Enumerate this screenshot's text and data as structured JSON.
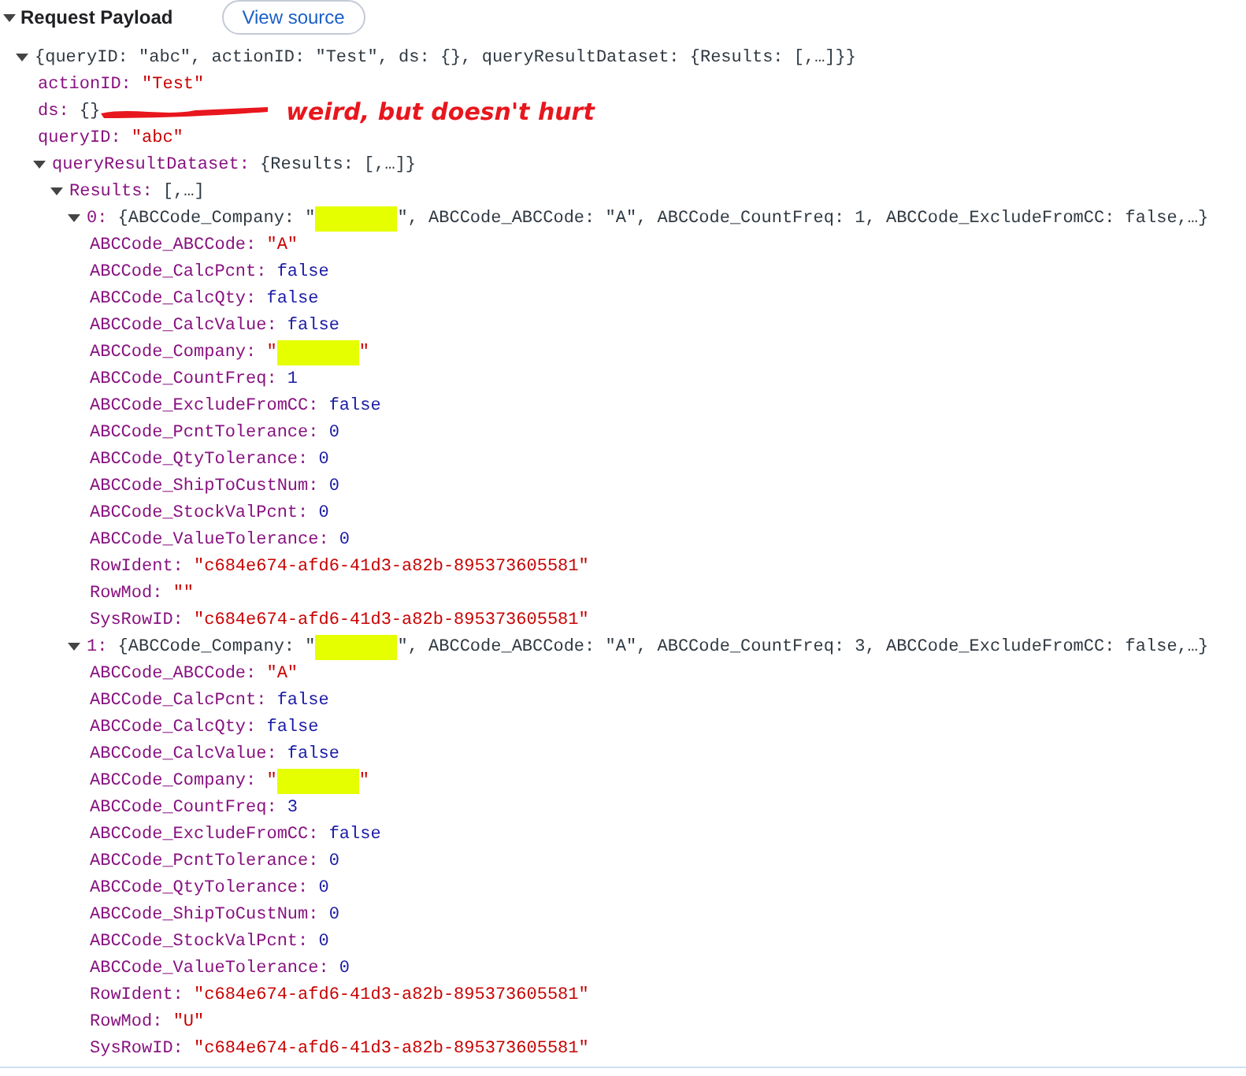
{
  "header": {
    "title": "Request Payload",
    "expanded": true,
    "view_source_button": "View source"
  },
  "tree": {
    "summary": [
      {
        "kind": "plain",
        "text": "{queryID: \"abc\", actionID: \"Test\", ds: {}, queryResultDataset: {Results: [,…]}}"
      }
    ],
    "expanded": true,
    "children": [
      {
        "key": "actionID:",
        "value": [
          {
            "kind": "string",
            "text": "\"Test\""
          }
        ]
      },
      {
        "key": "ds:",
        "value": [
          {
            "kind": "plain",
            "text": "{}"
          }
        ],
        "annotation": "weird, but doesn't hurt"
      },
      {
        "key": "queryID:",
        "value": [
          {
            "kind": "string",
            "text": "\"abc\""
          }
        ]
      },
      {
        "key": "queryResultDataset:",
        "summary": [
          {
            "kind": "plain",
            "text": "{Results: [,…]}"
          }
        ],
        "expanded": true,
        "children": [
          {
            "key": "Results:",
            "summary": [
              {
                "kind": "plain",
                "text": "[,…]"
              }
            ],
            "expanded": true,
            "children": [
              {
                "key": "0:",
                "summary": [
                  {
                    "kind": "plain",
                    "text": "{ABCCode_Company: \""
                  },
                  {
                    "kind": "redaction"
                  },
                  {
                    "kind": "plain",
                    "text": "\", ABCCode_ABCCode: \"A\", ABCCode_CountFreq: 1, ABCCode_ExcludeFromCC: false,…}"
                  }
                ],
                "expanded": true,
                "children": [
                  {
                    "key": "ABCCode_ABCCode:",
                    "value": [
                      {
                        "kind": "string",
                        "text": "\"A\""
                      }
                    ]
                  },
                  {
                    "key": "ABCCode_CalcPcnt:",
                    "value": [
                      {
                        "kind": "literal",
                        "text": "false"
                      }
                    ]
                  },
                  {
                    "key": "ABCCode_CalcQty:",
                    "value": [
                      {
                        "kind": "literal",
                        "text": "false"
                      }
                    ]
                  },
                  {
                    "key": "ABCCode_CalcValue:",
                    "value": [
                      {
                        "kind": "literal",
                        "text": "false"
                      }
                    ]
                  },
                  {
                    "key": "ABCCode_Company:",
                    "value": [
                      {
                        "kind": "string",
                        "text": "\""
                      },
                      {
                        "kind": "redaction"
                      },
                      {
                        "kind": "string",
                        "text": "\""
                      }
                    ]
                  },
                  {
                    "key": "ABCCode_CountFreq:",
                    "value": [
                      {
                        "kind": "literal",
                        "text": "1"
                      }
                    ]
                  },
                  {
                    "key": "ABCCode_ExcludeFromCC:",
                    "value": [
                      {
                        "kind": "literal",
                        "text": "false"
                      }
                    ]
                  },
                  {
                    "key": "ABCCode_PcntTolerance:",
                    "value": [
                      {
                        "kind": "literal",
                        "text": "0"
                      }
                    ]
                  },
                  {
                    "key": "ABCCode_QtyTolerance:",
                    "value": [
                      {
                        "kind": "literal",
                        "text": "0"
                      }
                    ]
                  },
                  {
                    "key": "ABCCode_ShipToCustNum:",
                    "value": [
                      {
                        "kind": "literal",
                        "text": "0"
                      }
                    ]
                  },
                  {
                    "key": "ABCCode_StockValPcnt:",
                    "value": [
                      {
                        "kind": "literal",
                        "text": "0"
                      }
                    ]
                  },
                  {
                    "key": "ABCCode_ValueTolerance:",
                    "value": [
                      {
                        "kind": "literal",
                        "text": "0"
                      }
                    ]
                  },
                  {
                    "key": "RowIdent:",
                    "value": [
                      {
                        "kind": "string",
                        "text": "\"c684e674-afd6-41d3-a82b-895373605581\""
                      }
                    ]
                  },
                  {
                    "key": "RowMod:",
                    "value": [
                      {
                        "kind": "string",
                        "text": "\"\""
                      }
                    ]
                  },
                  {
                    "key": "SysRowID:",
                    "value": [
                      {
                        "kind": "string",
                        "text": "\"c684e674-afd6-41d3-a82b-895373605581\""
                      }
                    ]
                  }
                ]
              },
              {
                "key": "1:",
                "summary": [
                  {
                    "kind": "plain",
                    "text": "{ABCCode_Company: \""
                  },
                  {
                    "kind": "redaction"
                  },
                  {
                    "kind": "plain",
                    "text": "\", ABCCode_ABCCode: \"A\", ABCCode_CountFreq: 3, ABCCode_ExcludeFromCC: false,…}"
                  }
                ],
                "expanded": true,
                "children": [
                  {
                    "key": "ABCCode_ABCCode:",
                    "value": [
                      {
                        "kind": "string",
                        "text": "\"A\""
                      }
                    ]
                  },
                  {
                    "key": "ABCCode_CalcPcnt:",
                    "value": [
                      {
                        "kind": "literal",
                        "text": "false"
                      }
                    ]
                  },
                  {
                    "key": "ABCCode_CalcQty:",
                    "value": [
                      {
                        "kind": "literal",
                        "text": "false"
                      }
                    ]
                  },
                  {
                    "key": "ABCCode_CalcValue:",
                    "value": [
                      {
                        "kind": "literal",
                        "text": "false"
                      }
                    ]
                  },
                  {
                    "key": "ABCCode_Company:",
                    "value": [
                      {
                        "kind": "string",
                        "text": "\""
                      },
                      {
                        "kind": "redaction"
                      },
                      {
                        "kind": "string",
                        "text": "\""
                      }
                    ]
                  },
                  {
                    "key": "ABCCode_CountFreq:",
                    "value": [
                      {
                        "kind": "literal",
                        "text": "3"
                      }
                    ]
                  },
                  {
                    "key": "ABCCode_ExcludeFromCC:",
                    "value": [
                      {
                        "kind": "literal",
                        "text": "false"
                      }
                    ]
                  },
                  {
                    "key": "ABCCode_PcntTolerance:",
                    "value": [
                      {
                        "kind": "literal",
                        "text": "0"
                      }
                    ]
                  },
                  {
                    "key": "ABCCode_QtyTolerance:",
                    "value": [
                      {
                        "kind": "literal",
                        "text": "0"
                      }
                    ]
                  },
                  {
                    "key": "ABCCode_ShipToCustNum:",
                    "value": [
                      {
                        "kind": "literal",
                        "text": "0"
                      }
                    ]
                  },
                  {
                    "key": "ABCCode_StockValPcnt:",
                    "value": [
                      {
                        "kind": "literal",
                        "text": "0"
                      }
                    ]
                  },
                  {
                    "key": "ABCCode_ValueTolerance:",
                    "value": [
                      {
                        "kind": "literal",
                        "text": "0"
                      }
                    ]
                  },
                  {
                    "key": "RowIdent:",
                    "value": [
                      {
                        "kind": "string",
                        "text": "\"c684e674-afd6-41d3-a82b-895373605581\""
                      }
                    ]
                  },
                  {
                    "key": "RowMod:",
                    "value": [
                      {
                        "kind": "string",
                        "text": "\"U\""
                      }
                    ]
                  },
                  {
                    "key": "SysRowID:",
                    "value": [
                      {
                        "kind": "string",
                        "text": "\"c684e674-afd6-41d3-a82b-895373605581\""
                      }
                    ]
                  }
                ]
              }
            ]
          }
        ]
      }
    ]
  }
}
